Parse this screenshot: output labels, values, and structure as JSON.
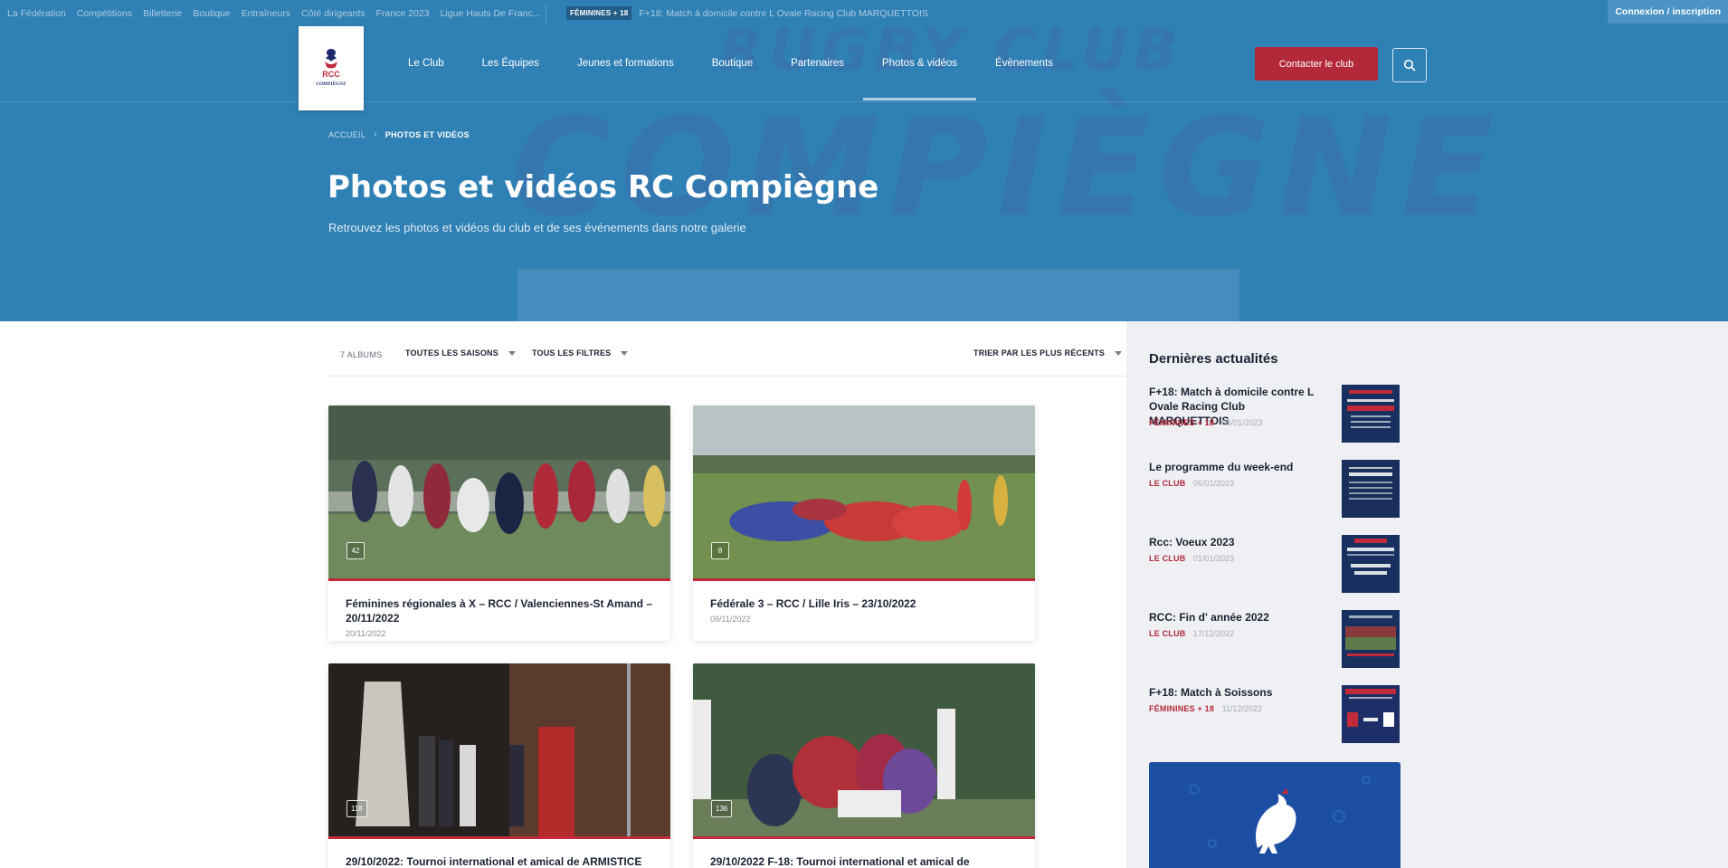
{
  "topbar": {
    "links": [
      "La Fédération",
      "Compétitions",
      "Billetterie",
      "Boutique",
      "Entraîneurs",
      "Côté dirigeants",
      "France 2023",
      "Ligue Hauts De Franc..."
    ],
    "ticker_badge": "FÉMININES + 18",
    "ticker_text": "F+18: Match à domicile contre L Ovale Racing Club MARQUETTOIS",
    "login_label": "Connexion / inscription"
  },
  "header": {
    "logo_text_top": "RCC",
    "logo_text_bottom": "COMPIÈGNE",
    "nav": [
      "Le Club",
      "Les Équipes",
      "Jeunes et formations",
      "Boutique",
      "Partenaires",
      "Photos & vidéos",
      "Évènements"
    ],
    "active_nav": "Photos & vidéos",
    "contact_label": "Contacter le club",
    "watermark_top": "RUGBY CLUB",
    "watermark_main": "COMPIÈGNE"
  },
  "hero": {
    "breadcrumb_home": "ACCUEIL",
    "breadcrumb_current": "PHOTOS ET VIDÉOS",
    "title": "Photos et vidéos RC Compiègne",
    "subtitle": "Retrouvez les photos et vidéos du club et de ses événements dans notre galerie"
  },
  "filters": {
    "album_count": "7 ALBUMS",
    "season": "TOUTES LES SAISONS",
    "filter": "TOUS LES FILTRES",
    "sort": "TRIER PAR LES PLUS RÉCENTS"
  },
  "albums": [
    {
      "title": "Féminines régionales à X – RCC / Valenciennes-St Amand – 20/11/2022",
      "date": "20/11/2022",
      "count": "42"
    },
    {
      "title": "Fédérale 3 – RCC / Lille Iris – 23/10/2022",
      "date": "09/11/2022",
      "count": "8"
    },
    {
      "title": "29/10/2022: Tournoi international et amical de ARMISTICE",
      "date": "",
      "count": "118"
    },
    {
      "title": "29/10/2022 F-18: Tournoi international et amical de",
      "date": "",
      "count": "136"
    }
  ],
  "sidebar": {
    "title": "Dernières actualités",
    "news": [
      {
        "title": "F+18: Match à domicile contre L Ovale Racing Club MARQUETTOIS",
        "category": "FÉMININES + 18",
        "date": "05/01/2023"
      },
      {
        "title": "Le programme du week-end",
        "category": "LE CLUB",
        "date": "06/01/2023"
      },
      {
        "title": "Rcc: Voeux 2023",
        "category": "LE CLUB",
        "date": "01/01/2023"
      },
      {
        "title": "RCC: Fin d' année 2022",
        "category": "LE CLUB",
        "date": "17/12/2022"
      },
      {
        "title": "F+18: Match à Soissons",
        "category": "FÉMININES + 18",
        "date": "11/12/2022"
      }
    ]
  },
  "colors": {
    "brand_blue": "#2f80b5",
    "accent_red": "#b32939",
    "sidebar_bg": "#eef0f3"
  }
}
